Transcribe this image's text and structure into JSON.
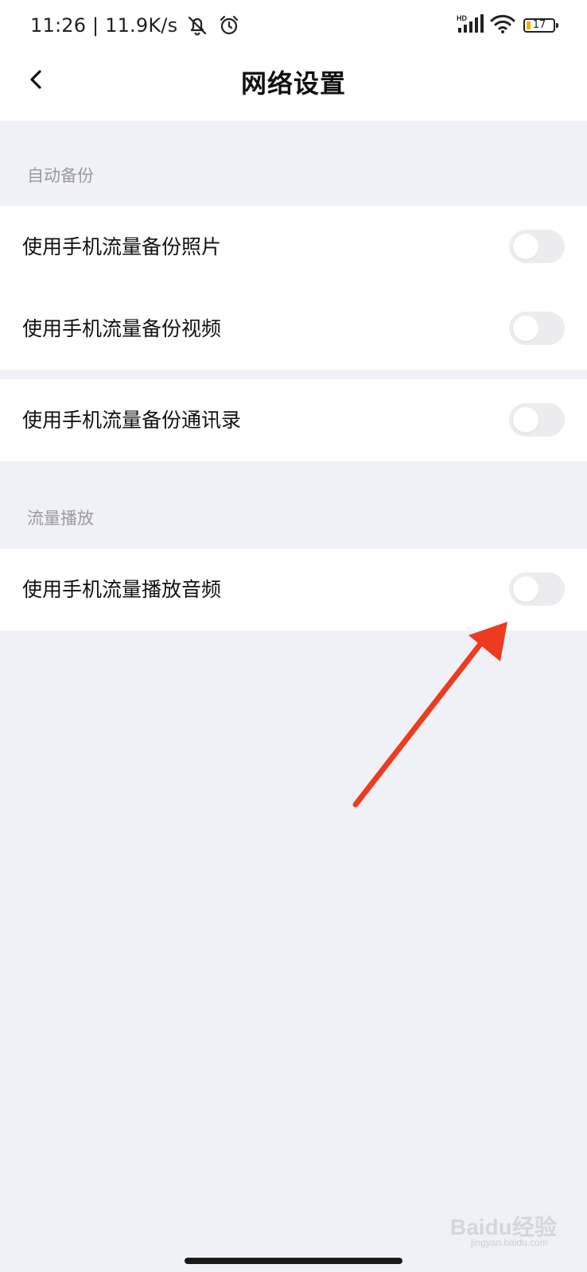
{
  "status_bar": {
    "time_and_speed": "11:26 | 11.9K/s",
    "network_label": "HD",
    "battery_level": "17",
    "icons": [
      "mute-bell-icon",
      "alarm-icon",
      "signal-icon",
      "wifi-icon",
      "battery-icon"
    ]
  },
  "header": {
    "title": "网络设置",
    "back_icon": "chevron-left-icon"
  },
  "sections": [
    {
      "label": "自动备份",
      "items": [
        {
          "label": "使用手机流量备份照片",
          "enabled": false
        },
        {
          "label": "使用手机流量备份视频",
          "enabled": false
        },
        {
          "label": "使用手机流量备份通讯录",
          "enabled": false
        }
      ]
    },
    {
      "label": "流量播放",
      "items": [
        {
          "label": "使用手机流量播放音频",
          "enabled": false
        }
      ]
    }
  ],
  "annotation": {
    "color": "#ee3a1f",
    "points_to": "使用手机流量播放音频"
  },
  "watermark": {
    "brand": "Baidu经验",
    "url": "jingyan.baidu.com"
  }
}
